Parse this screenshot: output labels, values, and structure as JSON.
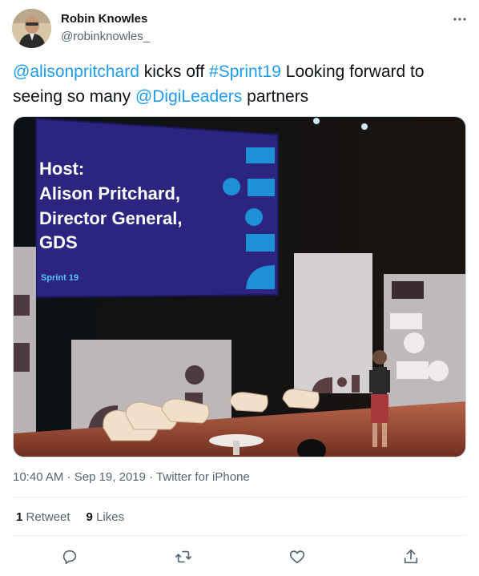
{
  "author": {
    "name": "Robin Knowles",
    "handle": "@robinknowles_"
  },
  "tweet": {
    "parts": [
      {
        "text": "@alisonpritchard",
        "link": true
      },
      {
        "text": " kicks off ",
        "link": false
      },
      {
        "text": "#Sprint19",
        "link": true
      },
      {
        "text": " Looking forward to seeing so many ",
        "link": false
      },
      {
        "text": "@DigiLeaders",
        "link": true
      },
      {
        "text": " partners",
        "link": false
      }
    ]
  },
  "media": {
    "screen_lines": [
      "Host:",
      "Alison Pritchard,",
      "Director General,",
      "GDS"
    ],
    "screen_tag": "Sprint 19"
  },
  "meta": {
    "time": "10:40 AM",
    "separator": " · ",
    "date": "Sep 19, 2019",
    "source": "Twitter for iPhone"
  },
  "stats": {
    "retweets_count": "1",
    "retweets_label": "Retweet",
    "likes_count": "9",
    "likes_label": "Likes"
  },
  "icons": {
    "more": "more-horizontal-icon",
    "reply": "reply-icon",
    "retweet": "retweet-icon",
    "like": "heart-icon",
    "share": "share-icon"
  },
  "colors": {
    "link": "#1d9bf0",
    "secondary_text": "#536471",
    "primary_text": "#0f1419",
    "divider": "#eff3f4"
  }
}
